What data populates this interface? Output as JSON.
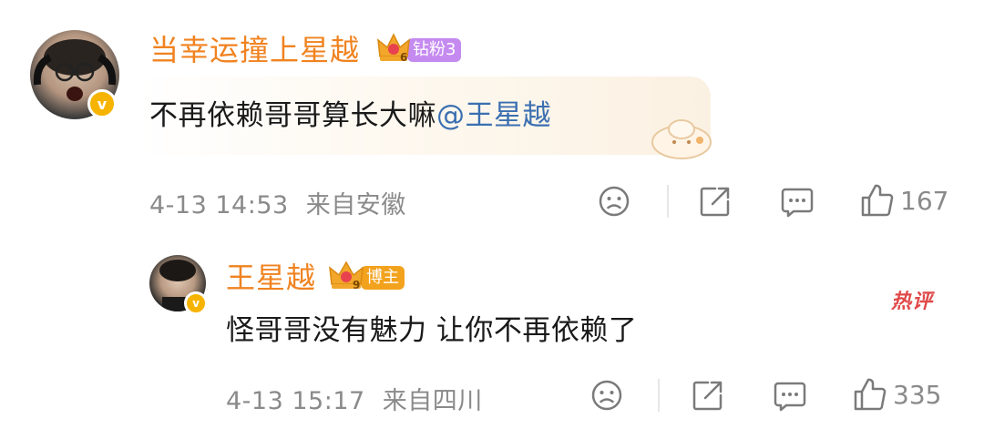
{
  "comments": [
    {
      "username": "当幸运撞上星越",
      "level_badge": "钻粉3",
      "crown_level": "6",
      "text": "不再依赖哥哥算长大嘛",
      "mention": "@王星越",
      "timestamp": "4-13 14:53",
      "location": "来自安徽",
      "like_count": "167"
    },
    {
      "username": "王星越",
      "level_badge": "博主",
      "crown_level": "9",
      "text": "怪哥哥没有魅力 让你不再依赖了",
      "hot_tag": "热评",
      "timestamp": "4-13 15:17",
      "location": "来自四川",
      "like_count": "335"
    }
  ],
  "icons": [
    "sad-face-icon",
    "share-icon",
    "comment-icon",
    "like-icon"
  ],
  "colors": {
    "username": "#f08320",
    "mention": "#3b6fb1",
    "meta": "#8a8a8a",
    "verified": "#f6b400",
    "fan_badge": "#c58af0",
    "blogger_badge": "#f3a21d",
    "hot": "#e04a4a"
  }
}
